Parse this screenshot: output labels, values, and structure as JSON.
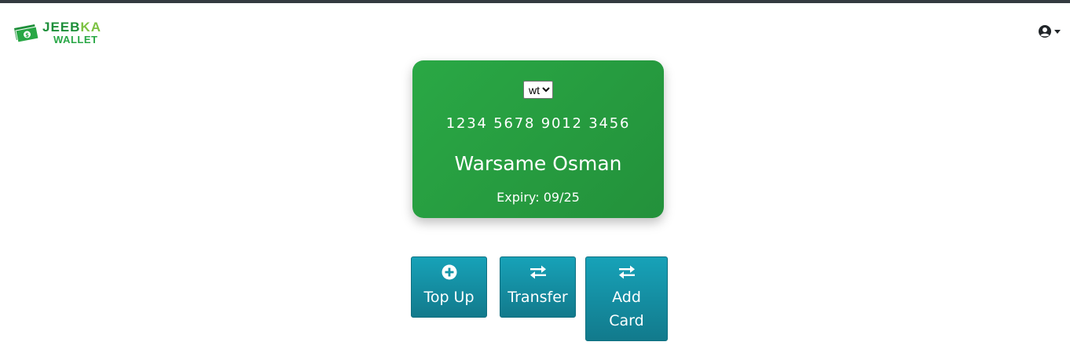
{
  "brand": {
    "line1_main": "JEEB",
    "line1_accent": "KA",
    "line2": "WALLET"
  },
  "header": {
    "user_icon": "user-circle-icon"
  },
  "card": {
    "selected_card": "wt",
    "number": "1234 5678 9012 3456",
    "holder": "Warsame Osman",
    "expiry": "Expiry: 09/25"
  },
  "actions": {
    "top_up": {
      "label": "Top Up",
      "icon": "plus-circle-icon"
    },
    "transfer": {
      "label": "Transfer",
      "icon": "exchange-icon"
    },
    "add_card": {
      "label": "Add Card",
      "icon": "exchange-icon"
    }
  },
  "colors": {
    "card_green": "#28a745",
    "button_teal": "#17a2b8",
    "topbar": "#343a40"
  }
}
